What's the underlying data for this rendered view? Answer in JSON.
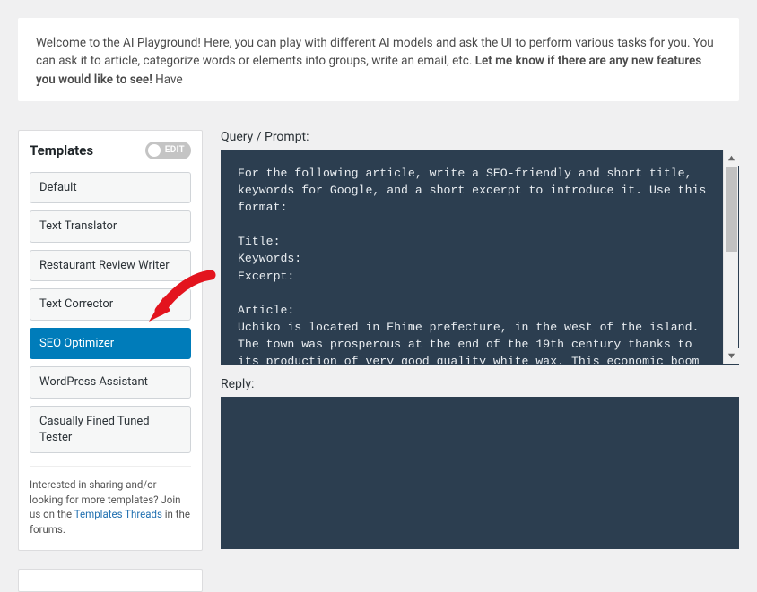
{
  "welcome": {
    "text_before_bold": "Welcome to the AI Playground! Here, you can play with different AI models and ask the UI to perform various tasks for you. You can ask it to article, categorize words or elements into groups, write an email, etc. ",
    "bold_text": "Let me know if there are any new features you would like to see!",
    "text_after_bold": " Have"
  },
  "sidebar": {
    "title": "Templates",
    "edit_label": "EDIT",
    "templates": [
      {
        "label": "Default",
        "active": false
      },
      {
        "label": "Text Translator",
        "active": false
      },
      {
        "label": "Restaurant Review Writer",
        "active": false
      },
      {
        "label": "Text Corrector",
        "active": false
      },
      {
        "label": "SEO Optimizer",
        "active": true
      },
      {
        "label": "WordPress Assistant",
        "active": false
      },
      {
        "label": "Casually Fined Tuned Tester",
        "active": false
      }
    ],
    "footer": {
      "before_link": "Interested in sharing and/or looking for more templates? Join us on the ",
      "link_text": "Templates Threads",
      "after_link": " in the forums."
    }
  },
  "main": {
    "query_label": "Query / Prompt:",
    "query_text": "For the following article, write a SEO-friendly and short title, keywords for Google, and a short excerpt to introduce it. Use this format:\n\nTitle:\nKeywords:\nExcerpt:\n\nArticle:\nUchiko is located in Ehime prefecture, in the west of the island. The town was prosperous at the end of the 19th century thanks to its production of very good quality white wax. This economic boom allowed wealthy local merchants to build beautiful properties, whose heritage is still visible throughout the town.",
    "reply_label": "Reply:"
  }
}
